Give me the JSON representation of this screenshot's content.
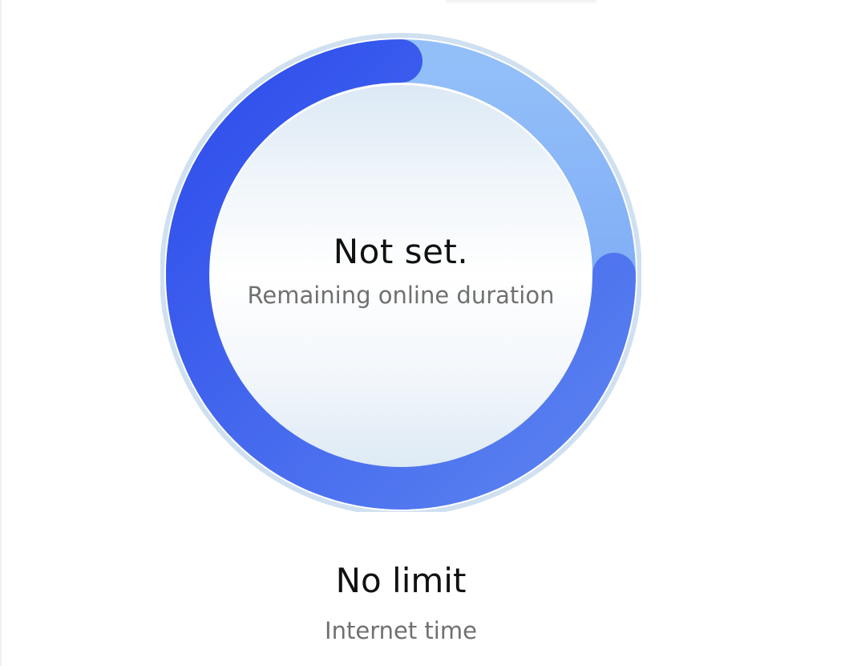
{
  "ring": {
    "progress_fraction": 0.75,
    "colors": {
      "progress_start": "#2d4cec",
      "progress_end": "#5c84f0",
      "track_start": "#93bff9",
      "track_end": "#6f9ef2",
      "outer_halo": "#cfe0f0"
    }
  },
  "remaining": {
    "value": "Not set.",
    "caption": "Remaining online duration"
  },
  "limit": {
    "value": "No limit",
    "caption": "Internet time"
  }
}
